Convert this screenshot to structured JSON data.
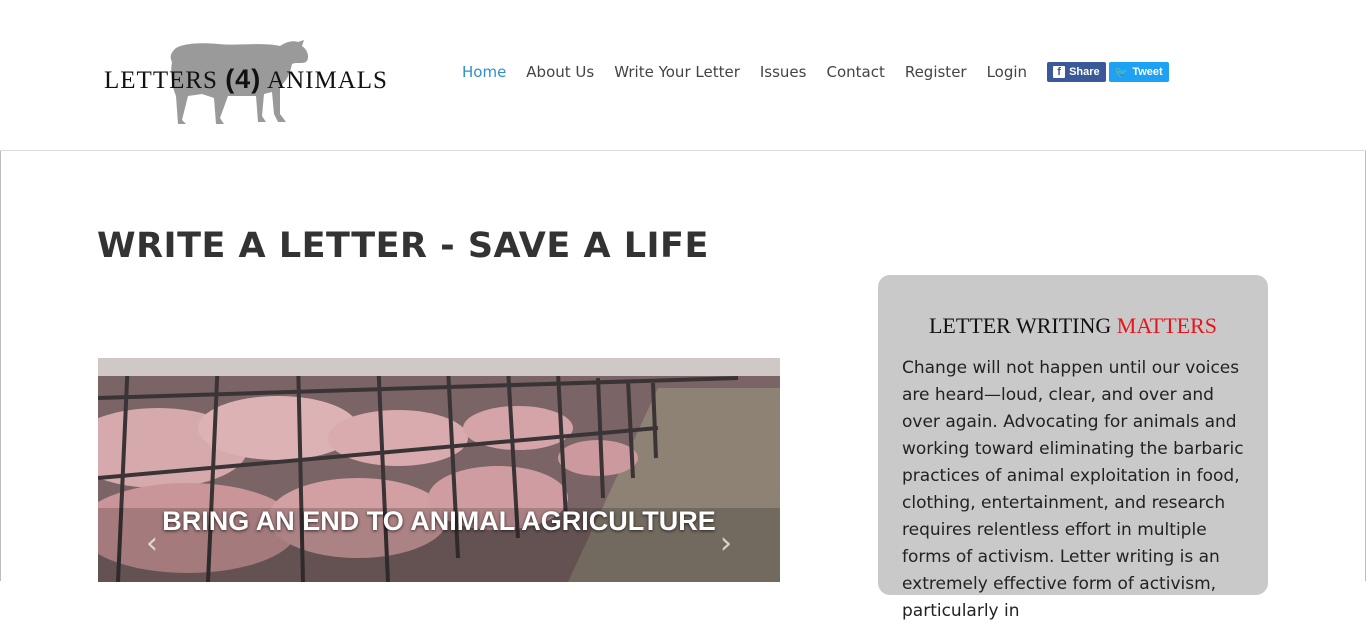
{
  "header": {
    "logo": {
      "text_left": "LETTERS",
      "text_middle": "(4)",
      "text_right": "ANIMALS"
    },
    "nav": [
      {
        "label": "Home",
        "active": true
      },
      {
        "label": "About Us",
        "active": false
      },
      {
        "label": "Write Your Letter",
        "active": false
      },
      {
        "label": "Issues",
        "active": false
      },
      {
        "label": "Contact",
        "active": false
      },
      {
        "label": "Register",
        "active": false
      },
      {
        "label": "Login",
        "active": false
      }
    ],
    "social": {
      "share_label": "Share",
      "tweet_label": "Tweet"
    }
  },
  "main": {
    "title": "WRITE A LETTER - SAVE A LIFE",
    "carousel": {
      "caption": "BRING AN END TO ANIMAL AGRICULTURE",
      "prev_glyph": "‹",
      "next_glyph": "›"
    }
  },
  "panel": {
    "title_prefix": "LETTER WRITING ",
    "title_highlight": "MATTERS",
    "body": "Change will not happen until our voices are heard—loud, clear, and over and over again. Advocating for animals and working toward eliminating the barbaric practices of animal exploitation in food, clothing, entertainment, and research requires relentless effort in multiple forms of activism. Letter writing is an extremely effective form of activism, particularly in"
  },
  "colors": {
    "nav_active": "#2e8fd0",
    "facebook": "#3b5998",
    "twitter": "#1da1f2",
    "highlight_red": "#e8141c",
    "panel_bg": "#c9c9c9"
  }
}
